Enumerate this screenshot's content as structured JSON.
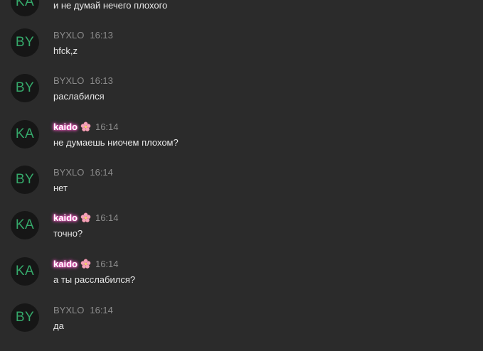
{
  "colors": {
    "background": "#2b2b2b",
    "avatar_bg": "#161616",
    "avatar_text": "#35a86a",
    "meta_text": "#8c8c8c",
    "message_text": "#e6e6e6",
    "kaido_glow": "#ff4fc1"
  },
  "messages": [
    {
      "avatar": "KA",
      "author": "",
      "time": "",
      "text": "и не думай нечего плохого"
    },
    {
      "avatar": "BY",
      "author": "BYXLO",
      "time": "16:13",
      "text": "hfck,z"
    },
    {
      "avatar": "BY",
      "author": "BYXLO",
      "time": "16:13",
      "text": "раслабился"
    },
    {
      "avatar": "KA",
      "author": "kaido",
      "author_icon": "cherry-blossom-icon",
      "time": "16:14",
      "text": "не думаешь ниочем плохом?"
    },
    {
      "avatar": "BY",
      "author": "BYXLO",
      "time": "16:14",
      "text": "нет"
    },
    {
      "avatar": "KA",
      "author": "kaido",
      "author_icon": "cherry-blossom-icon",
      "time": "16:14",
      "text": "точно?"
    },
    {
      "avatar": "KA",
      "author": "kaido",
      "author_icon": "cherry-blossom-icon",
      "time": "16:14",
      "text": "а ты расслабился?"
    },
    {
      "avatar": "BY",
      "author": "BYXLO",
      "time": "16:14",
      "text": "да"
    }
  ]
}
